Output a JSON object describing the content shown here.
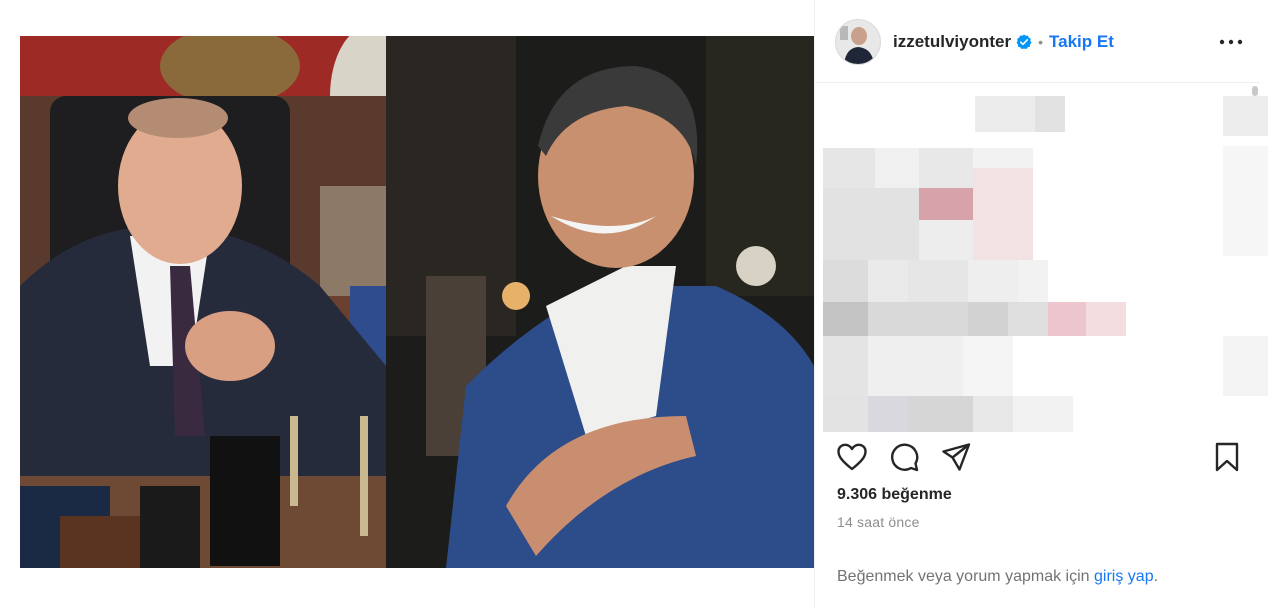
{
  "post": {
    "username": "izzetulviyonter",
    "separator": "•",
    "follow_label": "Takip Et",
    "likes": "9.306 beğenme",
    "time_ago": "14 saat önce",
    "login_prompt": "Beğenmek veya yorum yapmak için",
    "login_link": "giriş yap",
    "login_suffix": "."
  },
  "icons": {
    "verified": "verified-badge-icon",
    "more": "more-options-icon",
    "like": "heart-icon",
    "comment": "comment-icon",
    "share": "share-icon",
    "save": "bookmark-icon"
  },
  "colors": {
    "link": "#1877f2",
    "text": "#262626",
    "secondary": "#8e8e8e"
  }
}
